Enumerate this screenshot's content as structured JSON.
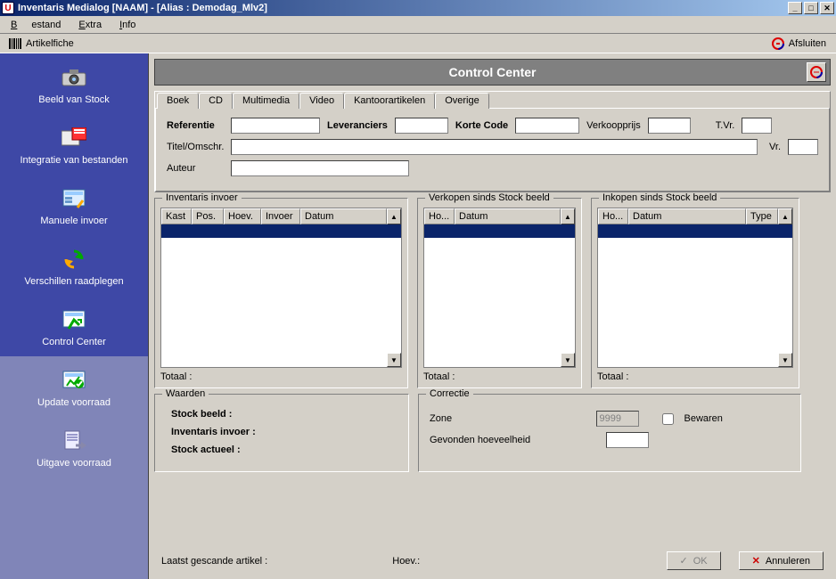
{
  "window": {
    "title": "Inventaris Medialog [NAAM] - [Alias : Demodag_Mlv2]"
  },
  "menu": {
    "bestand": "Bestand",
    "extra": "Extra",
    "info": "Info"
  },
  "toolbar": {
    "artikelfiche": "Artikelfiche",
    "afsluiten": "Afsluiten"
  },
  "sidebar": {
    "items": [
      {
        "label": "Beeld van Stock"
      },
      {
        "label": "Integratie van bestanden"
      },
      {
        "label": "Manuele invoer"
      },
      {
        "label": "Verschillen raadplegen"
      },
      {
        "label": "Control Center"
      },
      {
        "label": "Update voorraad"
      },
      {
        "label": "Uitgave voorraad"
      }
    ]
  },
  "header": {
    "title": "Control Center"
  },
  "tabs": {
    "boek": "Boek",
    "cd": "CD",
    "multimedia": "Multimedia",
    "video": "Video",
    "kantoor": "Kantoorartikelen",
    "overige": "Overige"
  },
  "form": {
    "referentie_label": "Referentie",
    "leveranciers_label": "Leveranciers",
    "korte_code_label": "Korte Code",
    "verkoopprijs_label": "Verkoopprijs",
    "tvr_label": "T.Vr.",
    "titel_label": "Titel/Omschr.",
    "vr_label": "Vr.",
    "auteur_label": "Auteur",
    "referentie": "",
    "leveranciers": "",
    "korte_code": "",
    "verkoopprijs": "",
    "tvr": "",
    "titel": "",
    "vr": "",
    "auteur": ""
  },
  "panels": {
    "inventaris": {
      "legend": "Inventaris invoer",
      "cols": [
        "Kast",
        "Pos.",
        "Hoev.",
        "Invoer",
        "Datum"
      ],
      "totaal": "Totaal :"
    },
    "verkopen": {
      "legend": "Verkopen sinds Stock beeld",
      "cols": [
        "Ho...",
        "Datum"
      ],
      "totaal": "Totaal :"
    },
    "inkopen": {
      "legend": "Inkopen sinds Stock beeld",
      "cols": [
        "Ho...",
        "Datum",
        "Type"
      ],
      "totaal": "Totaal :"
    }
  },
  "waarden": {
    "legend": "Waarden",
    "stock_beeld": "Stock beeld :",
    "inventaris_invoer": "Inventaris invoer :",
    "stock_actueel": "Stock actueel :"
  },
  "correctie": {
    "legend": "Correctie",
    "zone_label": "Zone",
    "zone_value": "9999",
    "bewaren_label": "Bewaren",
    "gevonden_label": "Gevonden hoeveelheid",
    "gevonden_value": ""
  },
  "status": {
    "laatst": "Laatst gescande artikel :",
    "hoev": "Hoev.:"
  },
  "buttons": {
    "ok": "OK",
    "annuleren": "Annuleren"
  }
}
